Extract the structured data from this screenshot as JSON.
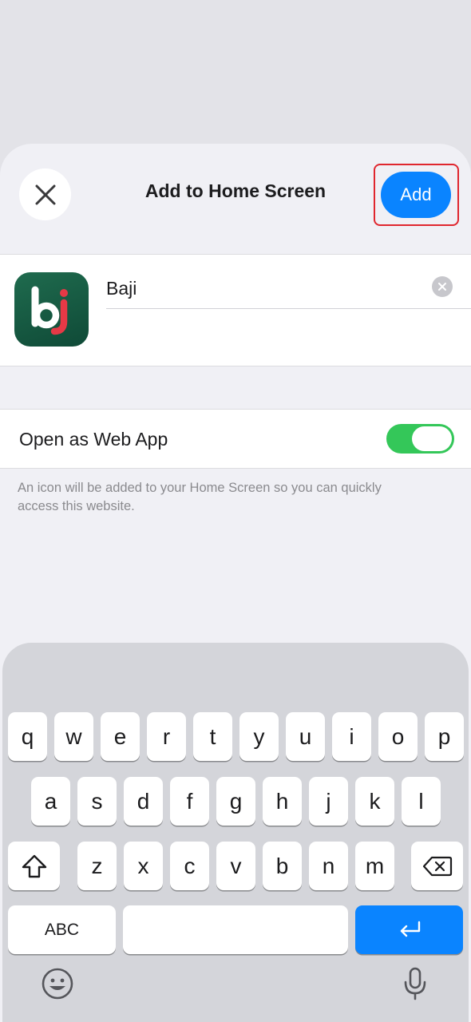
{
  "header": {
    "title": "Add to Home Screen",
    "add_label": "Add"
  },
  "app": {
    "icon_text": "bj",
    "name_value": "Baji"
  },
  "web_app_toggle": {
    "label": "Open as Web App",
    "state": "on"
  },
  "footnote": "An icon will be added to your Home Screen so you can quickly access this website.",
  "keyboard": {
    "row1": [
      "q",
      "w",
      "e",
      "r",
      "t",
      "y",
      "u",
      "i",
      "o",
      "p"
    ],
    "row2": [
      "a",
      "s",
      "d",
      "f",
      "g",
      "h",
      "j",
      "k",
      "l"
    ],
    "row3": [
      "z",
      "x",
      "c",
      "v",
      "b",
      "n",
      "m"
    ],
    "abc_label": "ABC"
  },
  "colors": {
    "accent": "#0a84ff",
    "toggle_on": "#34c759",
    "highlight_border": "#e0262e"
  }
}
